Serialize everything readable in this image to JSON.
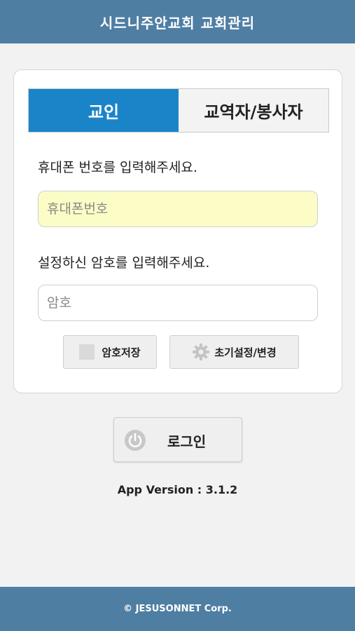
{
  "header": {
    "title": "시드니주안교회 교회관리"
  },
  "tabs": [
    {
      "label": "교인",
      "active": true
    },
    {
      "label": "교역자/봉사자",
      "active": false
    }
  ],
  "form": {
    "phone_prompt": "휴대폰 번호를 입력해주세요.",
    "phone_placeholder": "휴대폰번호",
    "password_prompt": "설정하신 암호를 입력해주세요.",
    "password_placeholder": "암호",
    "save_password_label": "암호저장",
    "reset_label": "초기설정/변경"
  },
  "login": {
    "label": "로그인",
    "icon": "power-icon"
  },
  "version": "App Version : 3.1.2",
  "footer": {
    "copyright": "© JESUSONNET Corp."
  },
  "colors": {
    "header_bg": "#4f7ea3",
    "tab_active_bg": "#1a84c9",
    "phone_field_bg": "#fcfdc6"
  }
}
